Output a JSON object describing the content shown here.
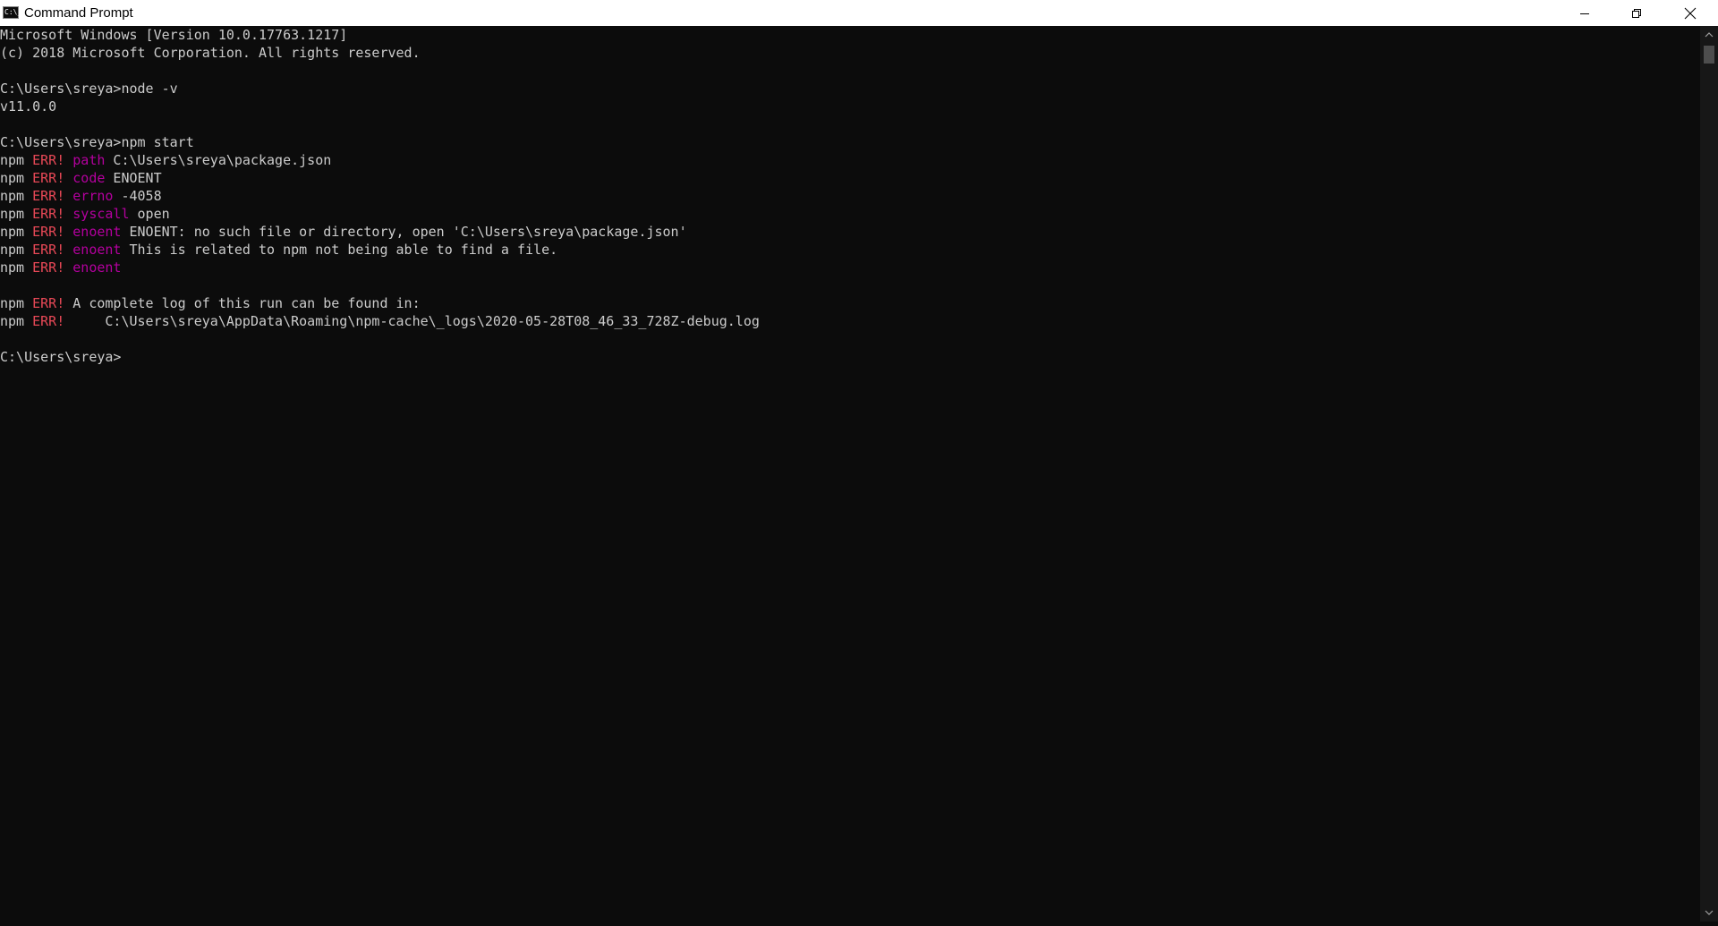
{
  "window": {
    "title": "Command Prompt",
    "icon": "cmd-app-icon",
    "icon_text": "C:\\_"
  },
  "controls": {
    "minimize_icon": "minimize-icon",
    "maximize_icon": "restore-icon",
    "close_icon": "close-icon"
  },
  "colors": {
    "background": "#0c0c0c",
    "text": "#cccccc",
    "err": "#e74856",
    "key": "#b4009e"
  },
  "terminal": {
    "lines": [
      [
        {
          "t": "Microsoft Windows [Version 10.0.17763.1217]",
          "c": "default"
        }
      ],
      [
        {
          "t": "(c) 2018 Microsoft Corporation. All rights reserved.",
          "c": "default"
        }
      ],
      [],
      [
        {
          "t": "C:\\Users\\sreya>node -v",
          "c": "default"
        }
      ],
      [
        {
          "t": "v11.0.0",
          "c": "default"
        }
      ],
      [],
      [
        {
          "t": "C:\\Users\\sreya>npm start",
          "c": "default"
        }
      ],
      [
        {
          "t": "npm ",
          "c": "default"
        },
        {
          "t": "ERR!",
          "c": "err"
        },
        {
          "t": " ",
          "c": "default"
        },
        {
          "t": "path",
          "c": "key"
        },
        {
          "t": " C:\\Users\\sreya\\package.json",
          "c": "default"
        }
      ],
      [
        {
          "t": "npm ",
          "c": "default"
        },
        {
          "t": "ERR!",
          "c": "err"
        },
        {
          "t": " ",
          "c": "default"
        },
        {
          "t": "code",
          "c": "key"
        },
        {
          "t": " ENOENT",
          "c": "default"
        }
      ],
      [
        {
          "t": "npm ",
          "c": "default"
        },
        {
          "t": "ERR!",
          "c": "err"
        },
        {
          "t": " ",
          "c": "default"
        },
        {
          "t": "errno",
          "c": "key"
        },
        {
          "t": " -4058",
          "c": "default"
        }
      ],
      [
        {
          "t": "npm ",
          "c": "default"
        },
        {
          "t": "ERR!",
          "c": "err"
        },
        {
          "t": " ",
          "c": "default"
        },
        {
          "t": "syscall",
          "c": "key"
        },
        {
          "t": " open",
          "c": "default"
        }
      ],
      [
        {
          "t": "npm ",
          "c": "default"
        },
        {
          "t": "ERR!",
          "c": "err"
        },
        {
          "t": " ",
          "c": "default"
        },
        {
          "t": "enoent",
          "c": "key"
        },
        {
          "t": " ENOENT: no such file or directory, open 'C:\\Users\\sreya\\package.json'",
          "c": "default"
        }
      ],
      [
        {
          "t": "npm ",
          "c": "default"
        },
        {
          "t": "ERR!",
          "c": "err"
        },
        {
          "t": " ",
          "c": "default"
        },
        {
          "t": "enoent",
          "c": "key"
        },
        {
          "t": " This is related to npm not being able to find a file.",
          "c": "default"
        }
      ],
      [
        {
          "t": "npm ",
          "c": "default"
        },
        {
          "t": "ERR!",
          "c": "err"
        },
        {
          "t": " ",
          "c": "default"
        },
        {
          "t": "enoent",
          "c": "key"
        }
      ],
      [],
      [
        {
          "t": "npm ",
          "c": "default"
        },
        {
          "t": "ERR!",
          "c": "err"
        },
        {
          "t": " A complete log of this run can be found in:",
          "c": "default"
        }
      ],
      [
        {
          "t": "npm ",
          "c": "default"
        },
        {
          "t": "ERR!",
          "c": "err"
        },
        {
          "t": "     C:\\Users\\sreya\\AppData\\Roaming\\npm-cache\\_logs\\2020-05-28T08_46_33_728Z-debug.log",
          "c": "default"
        }
      ],
      [],
      [
        {
          "t": "C:\\Users\\sreya>",
          "c": "default"
        }
      ]
    ]
  },
  "scrollbar": {
    "up_icon": "scroll-up-arrow-icon",
    "down_icon": "scroll-down-arrow-icon"
  }
}
